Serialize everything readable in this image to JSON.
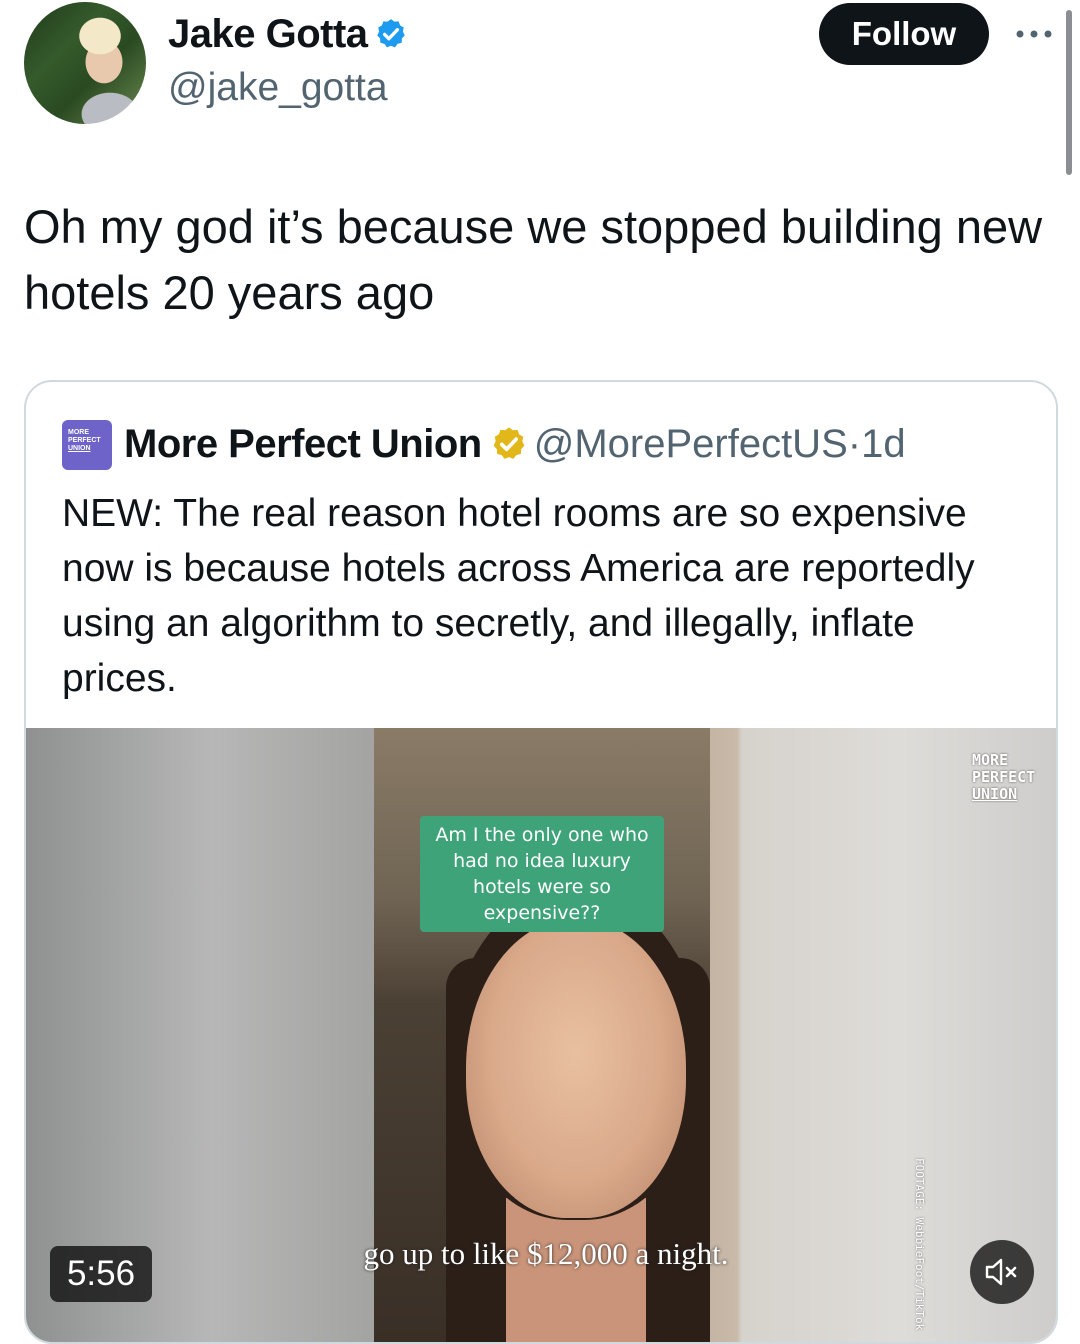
{
  "author": {
    "name": "Jake Gotta",
    "handle": "@jake_gotta",
    "verified": true,
    "avatar_icon": "avatar-photo"
  },
  "actions": {
    "follow_label": "Follow",
    "more_icon": "more-dots-icon"
  },
  "tweet": {
    "text": "Oh my god it’s because we stopped building new hotels 20 years ago"
  },
  "quote": {
    "logo_text": [
      "MORE",
      "PERFECT",
      "UNION"
    ],
    "name": "More Perfect Union",
    "badge": "gold-verified-badge",
    "handle": "@MorePerfectUS",
    "separator": "·",
    "time": "1d",
    "text": "NEW: The real reason hotel rooms are so expensive now is because hotels across America are reportedly using an algorithm to secretly, and illegally, inflate prices."
  },
  "video": {
    "caption": "Am I the only one who had no idea luxury hotels were so expensive??",
    "watermark": [
      "MORE",
      "PERFECT",
      "UNION"
    ],
    "footage_credit": "FOOTAGE: WebbieFoot/TikTok",
    "subtitle": "go up to like $12,000 a night.",
    "duration": "5:56",
    "mute_icon": "muted-speaker-icon"
  },
  "colors": {
    "text_primary": "#0f1419",
    "text_secondary": "#536471",
    "verified_blue": "#1d9bf0",
    "verified_gold": "#e2b719",
    "caption_green": "#3fa37a",
    "border": "#cfd9de"
  }
}
